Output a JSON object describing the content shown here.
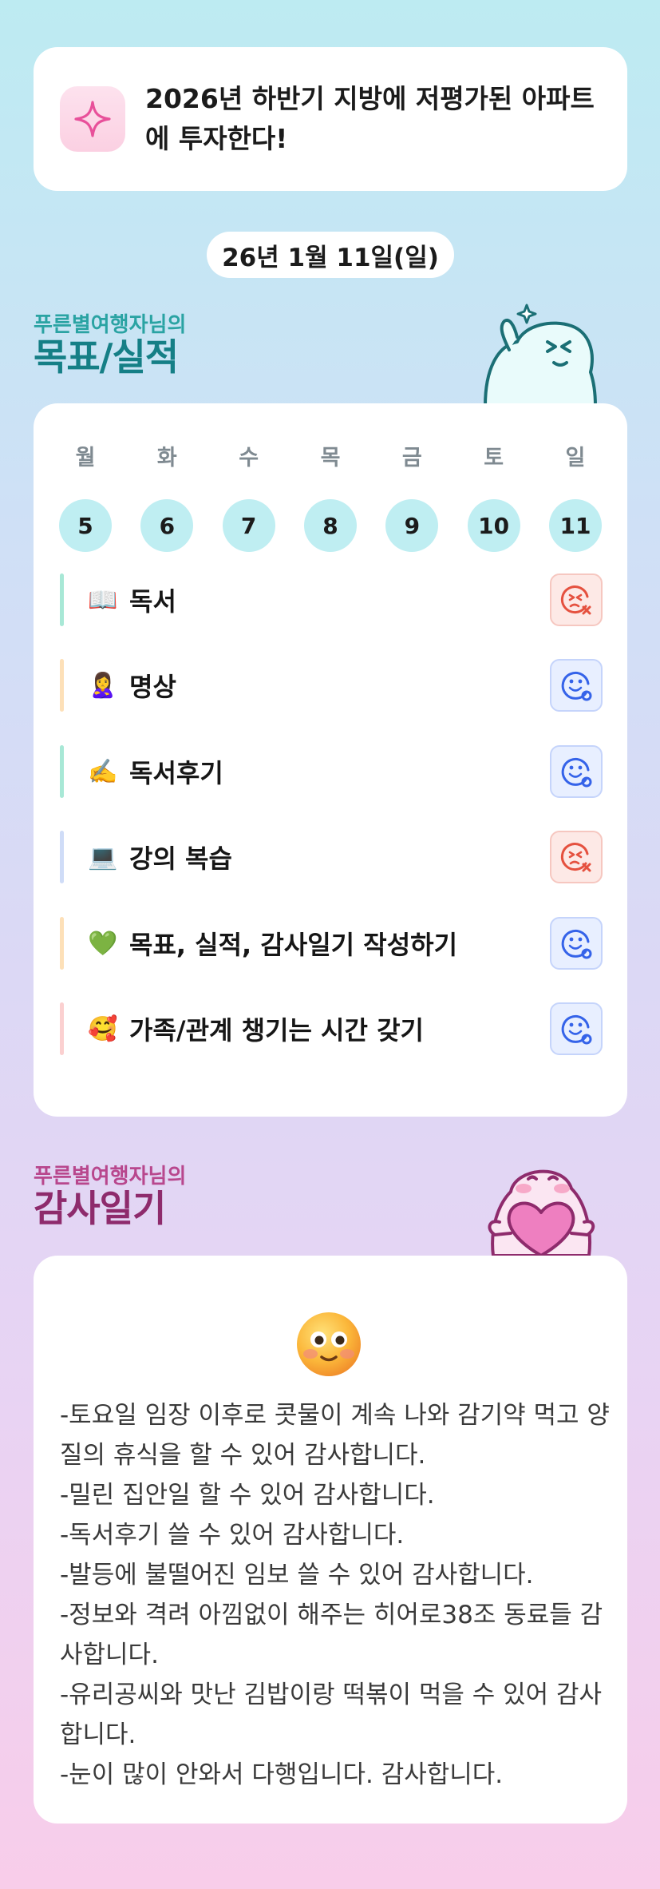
{
  "goal": {
    "icon": "sparkle-icon",
    "text": "2026년 하반기 지방에 저평가된 아파트에 투자한다!"
  },
  "date": "26년 1월 11일(일)",
  "sections": {
    "achievement": {
      "subtitle": "푸른별여행자님의",
      "title": "목표/실적"
    },
    "gratitude": {
      "subtitle": "푸른별여행자님의",
      "title": "감사일기"
    }
  },
  "week": [
    {
      "day": "월",
      "date": "5"
    },
    {
      "day": "화",
      "date": "6"
    },
    {
      "day": "수",
      "date": "7"
    },
    {
      "day": "목",
      "date": "8"
    },
    {
      "day": "금",
      "date": "9"
    },
    {
      "day": "토",
      "date": "10"
    },
    {
      "day": "일",
      "date": "11"
    }
  ],
  "tasks": [
    {
      "emoji": "📖",
      "label": "독서",
      "status": "fail",
      "bar": "#a8e8d6"
    },
    {
      "emoji": "🙎‍♀️",
      "label": "명상",
      "status": "done",
      "bar": "#fde0b8"
    },
    {
      "emoji": "✍️",
      "label": "독서후기",
      "status": "done",
      "bar": "#a8e8d6"
    },
    {
      "emoji": "💻",
      "label": "강의 복습",
      "status": "fail",
      "bar": "#cfdcf7"
    },
    {
      "emoji": "💚",
      "label": "목표, 실적, 감사일기 작성하기",
      "status": "done",
      "bar": "#fde0b8"
    },
    {
      "emoji": "🥰",
      "label": "가족/관계 챙기는 시간 갖기",
      "status": "done",
      "bar": "#fbd0d0"
    }
  ],
  "colors": {
    "fail": "#e5513f",
    "done": "#3563e9"
  },
  "gratitude_lines": [
    "-토요일 임장 이후로 콧물이 계속 나와 감기약 먹고 양질의 휴식을 할 수 있어 감사합니다.",
    "-밀린 집안일 할 수 있어 감사합니다.",
    "-독서후기 쓸 수 있어 감사합니다.",
    "-발등에 불떨어진 임보 쓸 수 있어 감사합니다.",
    "-정보와 격려 아낌없이 해주는 히어로38조 동료들 감사합니다.",
    "-유리공씨와 맛난 김밥이랑 떡볶이 먹을 수 있어 감사합니다.",
    "-눈이 많이 안와서 다행입니다. 감사합니다."
  ]
}
